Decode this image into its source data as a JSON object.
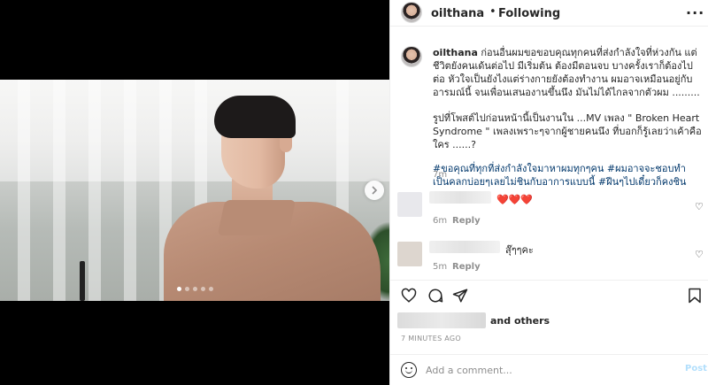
{
  "header": {
    "username": "oilthana",
    "separator": "•",
    "follow_status": "Following",
    "more_icon": "more-dots-icon"
  },
  "caption": {
    "username": "oilthana",
    "text_1": "ก่อนอื่นผมขอขอบคุณทุกคนที่ส่งกำลังใจที่ห่วงกัน แต่ชีวิตยังคนเด้นต่อไป มีเริ่มต้น ต้องมีตอนจบ บางครั้งเราก็ต้องไปต่อ หัวใจเป็นยังไงแต่ร่างกายยังต้องทำงาน ผมอาจเหมือนอยู่กับอารมณ์นี้ จนเพื่อนเสนองานขึ้นนึง มันไม่ได้ไกลจากตัวผม .........",
    "text_2": "รูปที่โพสต์ไปก่อนหน้านี้เป็นงานใน ...MV เพลง \" Broken Heart Syndrome \" เพลงเพราะๆจากผู้ชายคนนึง ที่บอกก็รู้เลยว่าเค้าคือใคร ......?",
    "hashtags": "#ขอคุณที่ทุกที่ส่งกำลังใจมาหาผมทุกๆคน #ผมอาจจะชอบทำเป็นคลกบ่อยๆเลยไม่ชินกับอาการแบบนี้ #ฝีนๆไปเดี๋ยวก็คงชิน",
    "time": "7m"
  },
  "comments": [
    {
      "text": "❤️❤️❤️",
      "time": "6m",
      "reply": "Reply"
    },
    {
      "text": "สุ๊ๆๆคะ",
      "time": "5m",
      "reply": "Reply"
    }
  ],
  "actions": {
    "like_icon": "heart-icon",
    "comment_icon": "comment-icon",
    "share_icon": "share-icon",
    "save_icon": "bookmark-icon"
  },
  "likes": {
    "others_text": "and others"
  },
  "post_time": "7 MINUTES AGO",
  "comment_box": {
    "placeholder": "Add a comment...",
    "post_label": "Post"
  },
  "carousel": {
    "total": 5,
    "active_index": 0
  }
}
